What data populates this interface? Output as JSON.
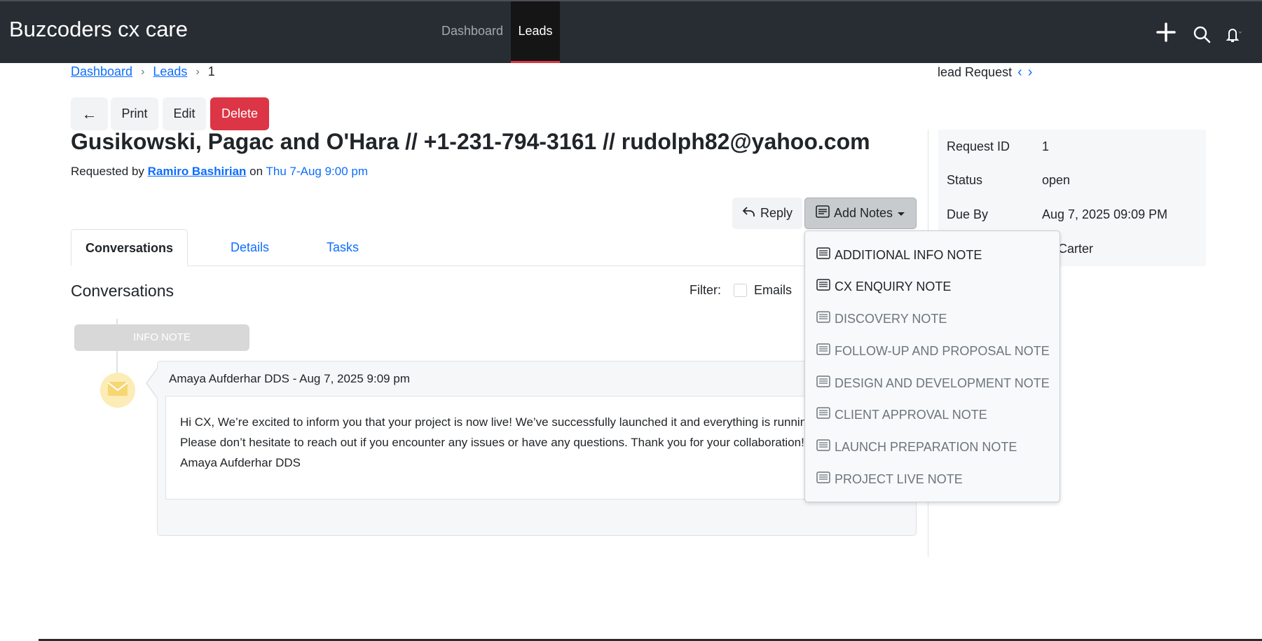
{
  "app": {
    "brand": "Buzcoders cx care"
  },
  "nav": {
    "dashboard": "Dashboard",
    "leads": "Leads"
  },
  "breadcrumb": {
    "dashboard": "Dashboard",
    "leads": "Leads",
    "current": "1"
  },
  "pager": {
    "label": "lead Request"
  },
  "toolbar": {
    "back": "←",
    "print": "Print",
    "edit": "Edit",
    "delete": "Delete"
  },
  "lead": {
    "title": "Gusikowski, Pagac and O'Hara // +1-231-794-3161 // rudolph82@yahoo.com",
    "requested_by_prefix": "Requested by",
    "requester": "Ramiro Bashirian",
    "on": "on",
    "date": "Thu 7-Aug 9:00 pm"
  },
  "actions": {
    "reply": "Reply",
    "add_notes": "Add Notes"
  },
  "tabs": {
    "conversations": "Conversations",
    "details": "Details",
    "tasks": "Tasks"
  },
  "conversations": {
    "heading": "Conversations",
    "filter_label": "Filter:",
    "filter_emails": "Emails",
    "badge": "INFO NOTE",
    "item": {
      "header": "Amaya Aufderhar DDS - Aug 7, 2025 9:09 pm",
      "body": "Hi CX, We’re excited to inform you that your project is now live! We’ve successfully launched it and everything is running smoothly. Please don’t hesitate to reach out if you encounter any issues or have any questions. Thank you for your collaboration! Best regards, Amaya Aufderhar DDS"
    }
  },
  "sidebar": {
    "request_id_label": "Request ID",
    "request_id": "1",
    "status_label": "Status",
    "status": "open",
    "due_label": "Due By",
    "due": "Aug 7, 2025 09:09 PM",
    "assignee": "nise Carter"
  },
  "notes_menu": [
    "ADDITIONAL INFO NOTE",
    "CX ENQUIRY NOTE",
    "DISCOVERY NOTE",
    "FOLLOW-UP AND PROPOSAL NOTE",
    "DESIGN AND DEVELOPMENT NOTE",
    "CLIENT APPROVAL NOTE",
    "LAUNCH PREPARATION NOTE",
    "PROJECT LIVE NOTE"
  ],
  "colors": {
    "topbar": "#272d33",
    "accent": "#0d6efd",
    "danger": "#dc3545",
    "envelope": "#f7d774"
  }
}
